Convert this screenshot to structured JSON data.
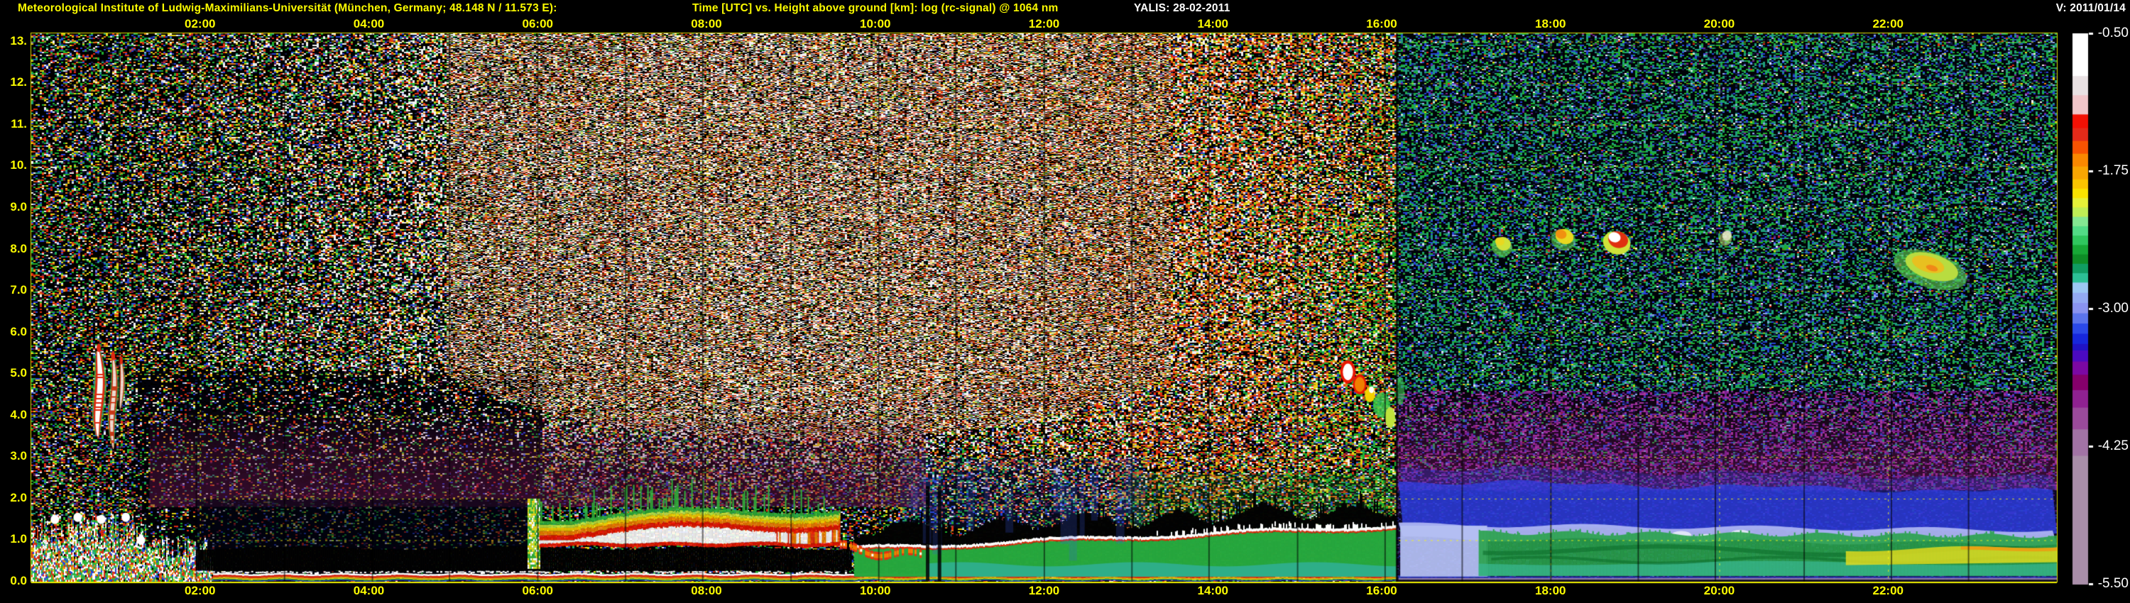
{
  "header": {
    "station_title": "Meteorological Institute of Ludwig-Maximilians-Universität (München, Germany; 48.148 N / 11.573 E):",
    "plot_title": "Time [UTC] vs. Height above ground [km]: log (rc-signal) @ 1064 nm",
    "system_date_label": "YALIS: 28-02-2011",
    "version_label": "V: 2011/01/14"
  },
  "colors": {
    "background": "#000000",
    "axis_text": "#fcfc00",
    "header_text_white": "#ffffff",
    "plot_border": "#d8d800",
    "grid": "#fafa14"
  },
  "chart_data": {
    "type": "heatmap",
    "title": "Time [UTC] vs. Height above ground [km]: log (rc-signal) @ 1064 nm",
    "instrument": "YALIS",
    "date": "28-02-2011",
    "xlabel": "Time [UTC]",
    "ylabel": "Height above ground [km]",
    "x_range_hours": [
      0,
      24
    ],
    "x_tick_hours": [
      2,
      4,
      6,
      8,
      10,
      12,
      14,
      16,
      18,
      20,
      22
    ],
    "x_tick_labels": [
      "02:00",
      "04:00",
      "06:00",
      "08:00",
      "10:00",
      "12:00",
      "14:00",
      "16:00",
      "18:00",
      "20:00",
      "22:00"
    ],
    "y_range_km": [
      0,
      13.2
    ],
    "y_tick_km": [
      13,
      12,
      11,
      10,
      9,
      8,
      7,
      6,
      5,
      4,
      3,
      2,
      1,
      0
    ],
    "y_tick_labels": [
      "13.",
      "12.",
      "11.",
      "10.",
      "9.0",
      "8.0",
      "7.0",
      "6.0",
      "5.0",
      "4.0",
      "3.0",
      "2.0",
      "1.0",
      "0.0"
    ],
    "hour_line_hours": [
      1,
      2,
      3,
      4,
      5,
      6,
      7,
      8,
      9,
      10,
      11,
      12,
      13,
      14,
      15,
      16,
      17,
      18,
      19,
      20,
      21,
      22,
      23
    ],
    "grid": {
      "vertical_every_h": 2,
      "horizontal_every_km": 1,
      "style": "dashed-yellow"
    },
    "colorbar": {
      "quantity": "log (rc-signal)",
      "value_range": [
        -0.5,
        -5.5
      ],
      "tick_labels": [
        "-0.50",
        "-1.75",
        "-3.00",
        "-4.25",
        "-5.50"
      ],
      "tick_fractions": [
        0,
        0.25,
        0.5,
        0.75,
        1
      ],
      "stops": [
        {
          "color": "#ffffff",
          "w": 10
        },
        {
          "color": "#e9e1e3",
          "w": 4.5
        },
        {
          "color": "#f1c5c9",
          "w": 4.5
        },
        {
          "color": "#f21105",
          "w": 3.2
        },
        {
          "color": "#e42a19",
          "w": 3.0
        },
        {
          "color": "#f85302",
          "w": 3.0
        },
        {
          "color": "#fa8800",
          "w": 3.0
        },
        {
          "color": "#f9a602",
          "w": 3.0
        },
        {
          "color": "#fac400",
          "w": 2.2
        },
        {
          "color": "#f8e200",
          "w": 2.2
        },
        {
          "color": "#e5f138",
          "w": 2.2
        },
        {
          "color": "#bfee55",
          "w": 2.2
        },
        {
          "color": "#84e892",
          "w": 2.2
        },
        {
          "color": "#52dc86",
          "w": 2.2
        },
        {
          "color": "#2fc75e",
          "w": 2.2
        },
        {
          "color": "#17a836",
          "w": 2.2
        },
        {
          "color": "#0e8c26",
          "w": 2.2
        },
        {
          "color": "#109c62",
          "w": 2.2
        },
        {
          "color": "#2cc096",
          "w": 2.2
        },
        {
          "color": "#9cc8f4",
          "w": 2.4
        },
        {
          "color": "#93aaf2",
          "w": 2.4
        },
        {
          "color": "#8a94f0",
          "w": 2.4
        },
        {
          "color": "#5b74ec",
          "w": 2.4
        },
        {
          "color": "#2b49e8",
          "w": 2.4
        },
        {
          "color": "#1727dc",
          "w": 2.4
        },
        {
          "color": "#2013c5",
          "w": 1.5
        },
        {
          "color": "#4b0ac1",
          "w": 2.6
        },
        {
          "color": "#7b08a3",
          "w": 3.1
        },
        {
          "color": "#85006b",
          "w": 3.6
        },
        {
          "color": "#8f2191",
          "w": 4.1
        },
        {
          "color": "#9a4a9b",
          "w": 5.1
        },
        {
          "color": "#a273a5",
          "w": 6.2
        },
        {
          "color": "#a98ea9",
          "w": 30
        }
      ]
    },
    "noise_palette": {
      "black": "#000000",
      "white": "#f2f2f2",
      "red": "#df2c10",
      "orange": "#e07818",
      "yellow": "#e6d414",
      "green": "#1fae2e",
      "teal": "#1f9e7a",
      "blue": "#2743d6",
      "light_blue": "#8ea6ea",
      "navy": "#141d4a",
      "maroon": "#6e1e46",
      "purple": "#7a1f92",
      "magenta": "#a83aa0"
    },
    "features": [
      {
        "name": "virga-precip-streaks",
        "t": [
          0.7,
          1.12
        ],
        "h": [
          2.6,
          5.7
        ],
        "appearance": "narrow vertical streaks, white cores, red rims, green fringe"
      },
      {
        "name": "near-range-clutter",
        "t": [
          0.0,
          2.15
        ],
        "h": [
          0.0,
          1.9
        ],
        "appearance": "dense multicolour clutter columns, white cloud patches near 1.5 km"
      },
      {
        "name": "surface-echo-stripe",
        "t": [
          0.0,
          16.17
        ],
        "h": [
          0.0,
          0.2
        ],
        "appearance": "layered white/red/yellow/green/blue stripe at ground"
      },
      {
        "name": "low-signal-black-band",
        "t": [
          1.95,
          9.7
        ],
        "h": [
          0.24,
          0.82
        ],
        "appearance": "black band with white speckled base"
      },
      {
        "name": "stratus-fog-deck",
        "t": [
          5.88,
          9.58
        ],
        "h": [
          0.82,
          2.5
        ],
        "appearance": "saturated white core rimmed red, orange-yellow-green halo, green spikes"
      },
      {
        "name": "deck-remnants",
        "t": [
          9.58,
          10.55
        ],
        "h": [
          0.45,
          1.05
        ],
        "appearance": "decaying red-orange patches"
      },
      {
        "name": "rising-cloud-base-band",
        "t": [
          9.75,
          16.17
        ],
        "h": [
          0.7,
          1.6
        ],
        "appearance": "black attenuated band above bright white cloud-base line rising 0.8 to 1.3 km"
      },
      {
        "name": "mixed-layer-aerosol",
        "t": [
          9.75,
          16.17
        ],
        "h": [
          0.1,
          0.9
        ],
        "appearance": "green layer with teal lower half"
      },
      {
        "name": "blue-plumes",
        "t": [
          10.3,
          13.2
        ],
        "h": [
          1.3,
          3.2
        ],
        "appearance": "faint blue vertical plumes"
      },
      {
        "name": "pm-green-speckle",
        "t": [
          13.0,
          16.17
        ],
        "h": [
          1.25,
          2.6
        ],
        "appearance": "green speckle above band"
      },
      {
        "name": "mid-level-cloud",
        "t": [
          15.45,
          16.35
        ],
        "h": [
          3.5,
          5.4
        ],
        "appearance": "broken white/red/orange cloud with green fringe, descending"
      },
      {
        "name": "cirrus-patch-1",
        "t": [
          17.3,
          17.55
        ],
        "h": [
          7.9,
          8.35
        ],
        "appearance": "green-yellow"
      },
      {
        "name": "cirrus-patch-2",
        "t": [
          18.0,
          18.3
        ],
        "h": [
          8.05,
          8.55
        ],
        "appearance": "yellow-orange"
      },
      {
        "name": "cirrus-patch-3",
        "t": [
          18.62,
          18.95
        ],
        "h": [
          7.95,
          8.5
        ],
        "appearance": "white core, red rim"
      },
      {
        "name": "cirrus-patch-4",
        "t": [
          20.0,
          20.15
        ],
        "h": [
          8.15,
          8.5
        ],
        "appearance": "small faint"
      },
      {
        "name": "cirrus-patch-5",
        "t": [
          22.05,
          22.95
        ],
        "h": [
          7.15,
          8.0
        ],
        "appearance": "yellow-orange core, green fringe"
      },
      {
        "name": "dusk-pale-blue-layer",
        "t": [
          16.22,
          17.25
        ],
        "h": [
          0.12,
          1.35
        ],
        "appearance": "pale periwinkle block"
      },
      {
        "name": "nocturnal-green-layer",
        "t": [
          17.15,
          24.0
        ],
        "h": [
          0.14,
          1.2
        ],
        "appearance": "stratified green, darker arcs, turquoise base"
      },
      {
        "name": "nbl-yellow-enhancement",
        "t": [
          21.5,
          24.0
        ],
        "h": [
          0.4,
          1.0
        ],
        "appearance": "yellow band, orange top edge after 23:00"
      },
      {
        "name": "residual-blue-band",
        "t": [
          16.2,
          24.0
        ],
        "h": [
          1.3,
          2.45
        ],
        "appearance": "blue band with pale periwinkle cap, slowly descending"
      },
      {
        "name": "night-purple-haze",
        "t": [
          16.17,
          24.0
        ],
        "h": [
          2.2,
          4.8
        ],
        "appearance": "magenta-purple speckle haze"
      },
      {
        "name": "day-maroon-haze",
        "t": [
          1.4,
          10.6
        ],
        "h": [
          1.8,
          4.2
        ],
        "appearance": "dark maroon haze"
      },
      {
        "name": "daylight-noise",
        "t": [
          5.2,
          16.17
        ],
        "h": [
          2.5,
          13.2
        ],
        "appearance": "bright white/red solar noise, orange-brown after 12:00"
      },
      {
        "name": "night-speckle",
        "t": [
          16.17,
          24.0
        ],
        "h": [
          4.6,
          13.2
        ],
        "appearance": "teal-green speckle on dark blue"
      }
    ]
  }
}
